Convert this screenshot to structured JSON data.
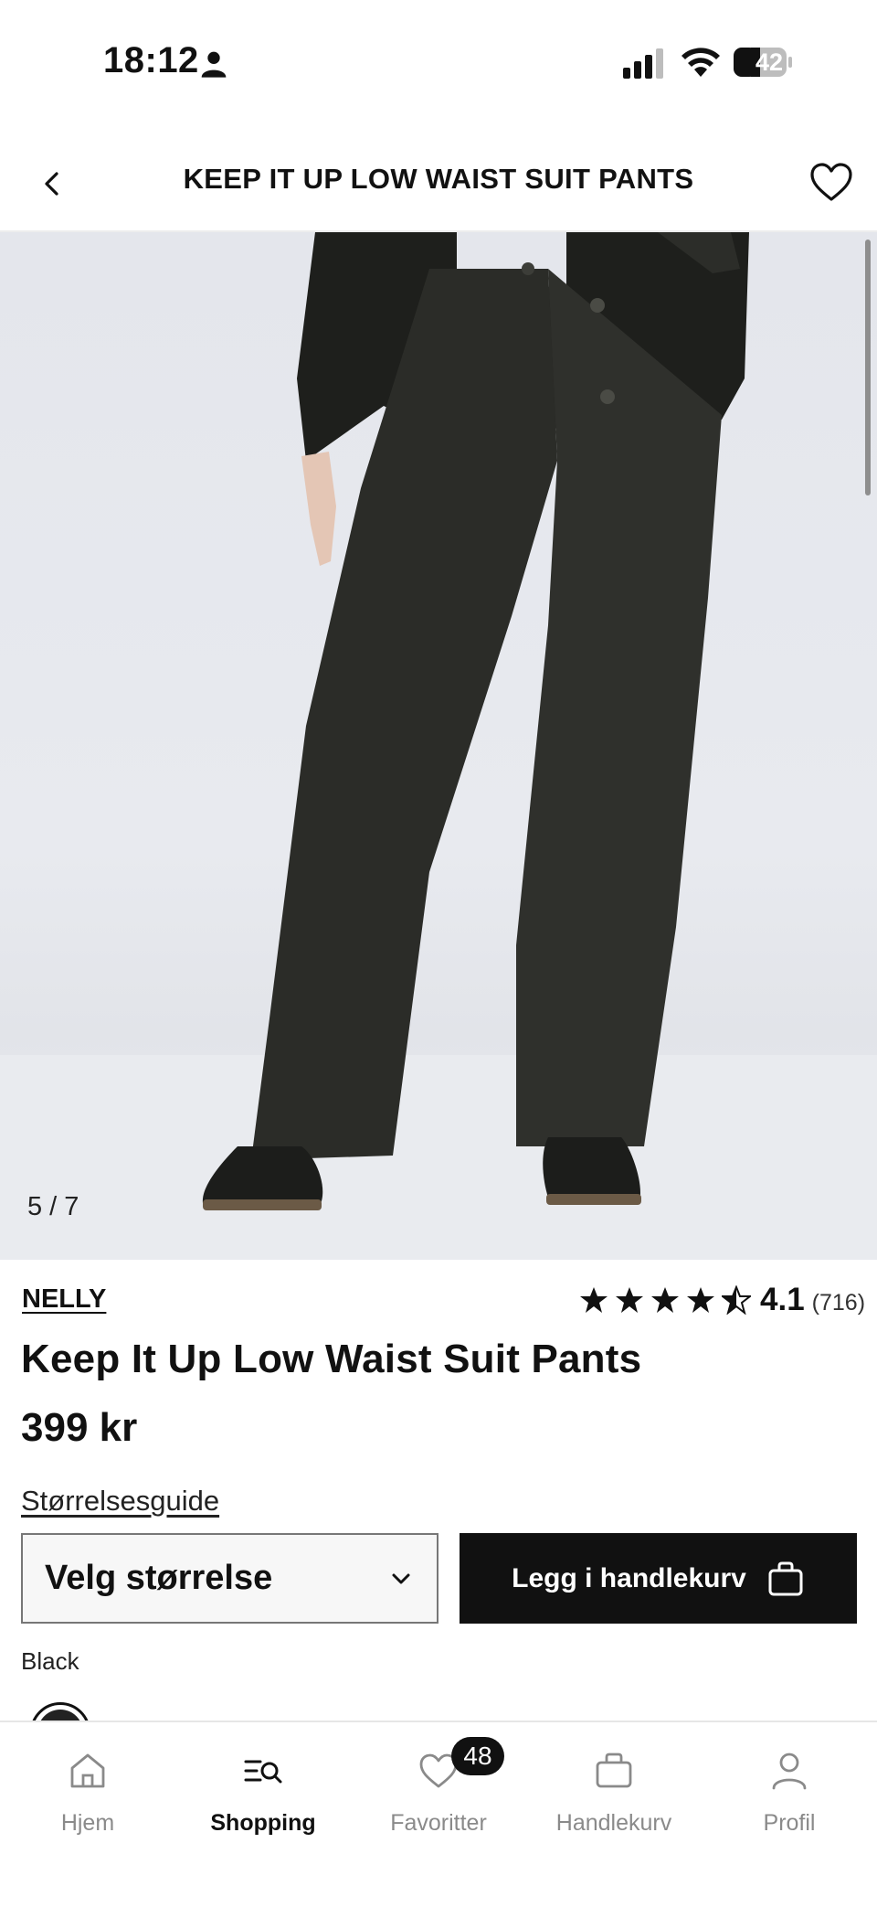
{
  "status_bar": {
    "time": "18:12",
    "battery": "42",
    "icons": [
      "person-icon",
      "signal-icon",
      "wifi-icon",
      "battery-icon"
    ]
  },
  "header": {
    "title": "KEEP IT UP LOW WAIST SUIT PANTS",
    "back_icon": "chevron-left-icon",
    "favorite_icon": "heart-icon"
  },
  "gallery": {
    "counter": "5 / 7",
    "current_index": 5,
    "total": 7,
    "image_description_icon": "product-photo"
  },
  "product": {
    "brand": "NELLY",
    "rating_value": "4.1",
    "rating_count": "(716)",
    "rating_numeric": 4.1,
    "name": "Keep It Up Low Waist Suit Pants",
    "price": "399 kr"
  },
  "actions": {
    "size_guide": "Størrelsesguide",
    "size_select": "Velg størrelse",
    "add_to_cart": "Legg i handlekurv"
  },
  "color": {
    "label": "Black",
    "swatch_color": "#222222"
  },
  "tab_bar": {
    "items": [
      {
        "label": "Hjem",
        "icon": "home-icon",
        "active": false
      },
      {
        "label": "Shopping",
        "icon": "search-list-icon",
        "active": true
      },
      {
        "label": "Favoritter",
        "icon": "heart-icon",
        "active": false,
        "badge": "48"
      },
      {
        "label": "Handlekurv",
        "icon": "bag-icon",
        "active": false
      },
      {
        "label": "Profil",
        "icon": "person-icon",
        "active": false
      }
    ]
  },
  "colors": {
    "accent": "#111111",
    "inactive": "#8a8a8a",
    "background": "#ffffff"
  }
}
